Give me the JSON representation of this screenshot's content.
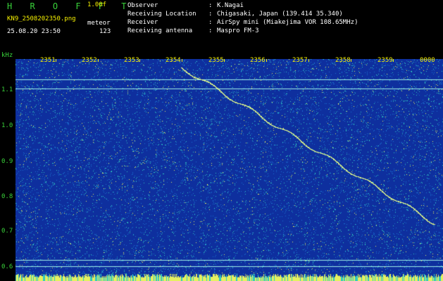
{
  "header": {
    "brand": "H R O F F T",
    "version": "1.00f",
    "filename": "KN9_2508202350.png",
    "timestamp": "25.08.20 23:50",
    "meteor_label": "meteor",
    "meteor_count": "123"
  },
  "info": [
    {
      "key": "Observer",
      "value": "K.Nagai"
    },
    {
      "key": "Receiving Location",
      "value": "Chigasaki, Japan (139.414 35.340)"
    },
    {
      "key": "Receiver",
      "value": "AirSpy mini (Miakejima VOR 108.65MHz)"
    },
    {
      "key": "Receiving antenna",
      "value": "Maspro FM-3"
    }
  ],
  "separator": ":",
  "spectrogram": {
    "y_unit": "kHz",
    "y_ticks": [
      "1.1",
      "1.0",
      "0.9",
      "0.8",
      "0.7",
      "0.6"
    ],
    "x_ticks": [
      "2351",
      "2352",
      "2353",
      "2354",
      "2355",
      "2356",
      "2357",
      "2358",
      "2359",
      "0000"
    ],
    "colors": {
      "background": "#0e2f9e",
      "noise_low": "#1a6fd0",
      "noise_mid": "#31c8c0",
      "noise_high": "#e6f060",
      "label_green": "#39d23a",
      "label_yellow": "#f7f200"
    }
  }
}
